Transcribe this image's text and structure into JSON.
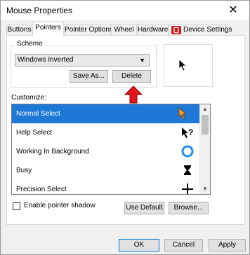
{
  "window": {
    "title": "Mouse Properties",
    "close_glyph": "✕"
  },
  "tabs": [
    {
      "label": "Buttons",
      "active": false
    },
    {
      "label": "Pointers",
      "active": true
    },
    {
      "label": "Pointer Options",
      "active": false
    },
    {
      "label": "Wheel",
      "active": false
    },
    {
      "label": "Hardware",
      "active": false
    },
    {
      "label": "Device Settings",
      "active": false,
      "icon": "device-settings-icon"
    }
  ],
  "scheme": {
    "legend": "Scheme",
    "selected": "Windows Inverted",
    "save_as_label": "Save As...",
    "delete_label": "Delete"
  },
  "customize": {
    "label": "Customize:",
    "items": [
      {
        "label": "Normal Select",
        "icon": "arrow-cursor-orange-icon",
        "selected": true
      },
      {
        "label": "Help Select",
        "icon": "help-cursor-icon",
        "selected": false
      },
      {
        "label": "Working In Background",
        "icon": "busy-ring-icon",
        "selected": false
      },
      {
        "label": "Busy",
        "icon": "hourglass-icon",
        "selected": false
      },
      {
        "label": "Precision Select",
        "icon": "crosshair-icon",
        "selected": false
      }
    ]
  },
  "pointer_shadow": {
    "label": "Enable pointer shadow",
    "checked": false
  },
  "buttons": {
    "use_default": "Use Default",
    "browse": "Browse...",
    "ok": "OK",
    "cancel": "Cancel",
    "apply": "Apply"
  },
  "colors": {
    "accent": "#1e78d7",
    "annotation_arrow": "#e0161c",
    "device_settings_icon": "#d21c1c"
  }
}
